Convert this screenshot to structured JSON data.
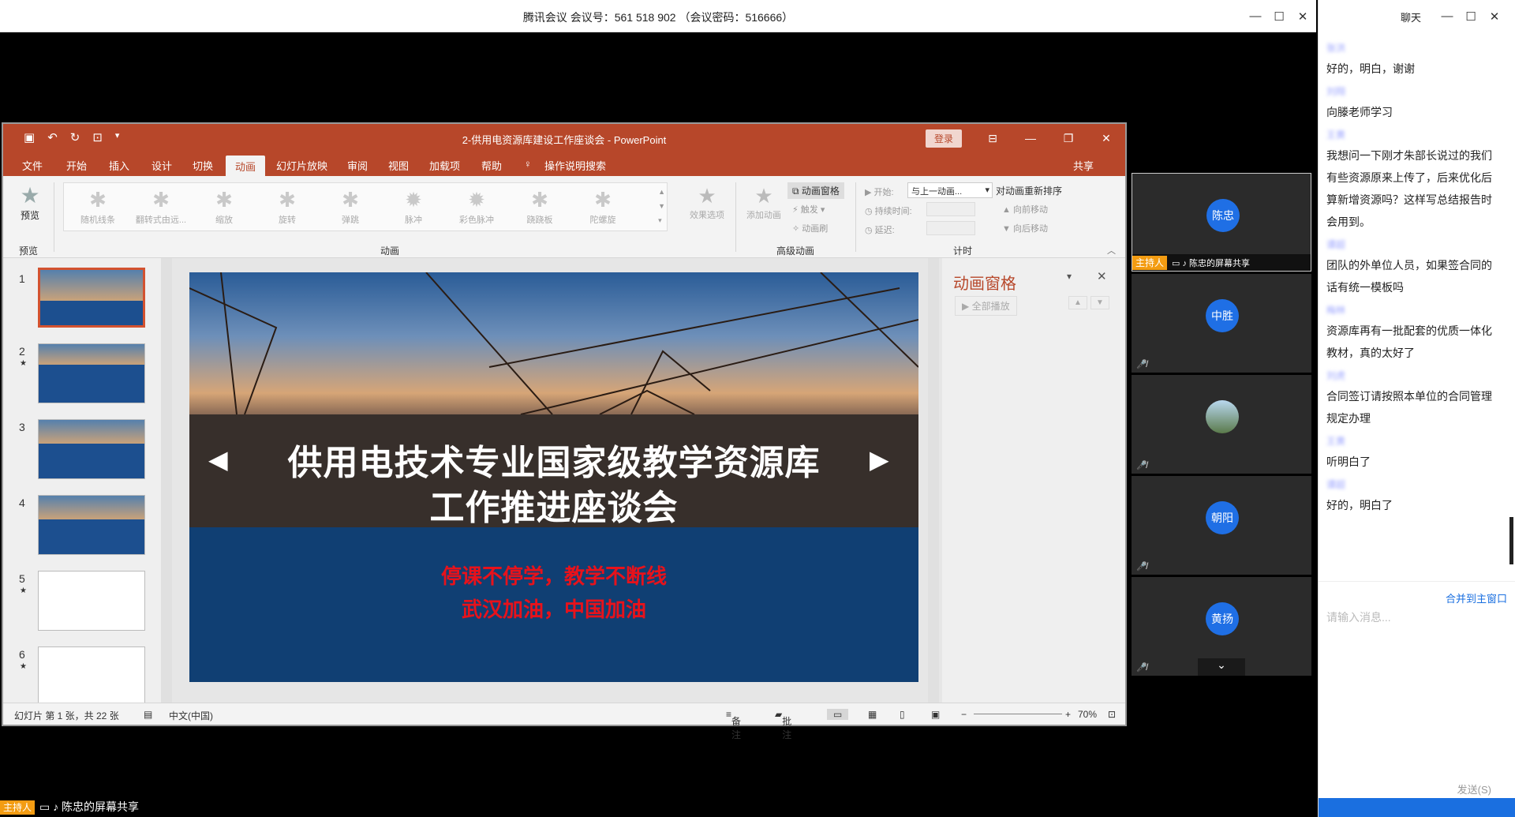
{
  "meeting": {
    "title": "腾讯会议 会议号：561 518 902 （会议密码：516666）",
    "win_min": "—",
    "win_max": "☐",
    "win_close": "✕"
  },
  "ppt": {
    "title": "2-供用电资源库建设工作座谈会  -  PowerPoint",
    "login": "登录",
    "tabs": [
      "文件",
      "开始",
      "插入",
      "设计",
      "切换",
      "动画",
      "幻灯片放映",
      "审阅",
      "视图",
      "加载项",
      "帮助",
      "操作说明搜索",
      "共享"
    ],
    "preview_label": "预览",
    "preview_group": "预览",
    "animations": [
      "随机线条",
      "翻转式由远...",
      "缩放",
      "旋转",
      "弹跳",
      "脉冲",
      "彩色脉冲",
      "跷跷板",
      "陀螺旋"
    ],
    "effect_options": "效果选项",
    "anim_group": "动画",
    "add_anim": "添加动画",
    "anim_pane_btn": "动画窗格",
    "trigger": "触发",
    "anim_brush": "动画刷",
    "adv_group": "高级动画",
    "start_label": "开始:",
    "start_value": "与上一动画...",
    "duration_label": "持续时间:",
    "delay_label": "延迟:",
    "timing_group": "计时",
    "reorder": "对动画重新排序",
    "move_earlier": "向前移动",
    "move_later": "向后移动",
    "slide_nums": [
      "1",
      "2",
      "3",
      "4",
      "5",
      "6"
    ],
    "slide_title_1": "供用电技术专业国家级教学资源库",
    "slide_title_2": "工作推进座谈会",
    "slide_red_1": "停课不停学，教学不断线",
    "slide_red_2": "武汉加油，中国加油",
    "anim_pane_title": "动画窗格",
    "play_all": "全部播放",
    "status_slide": "幻灯片 第 1 张，共 22 张",
    "status_lang": "中文(中国)",
    "status_notes": "备注",
    "status_comments": "批注",
    "zoom": "70%"
  },
  "video": {
    "tiles": [
      {
        "avatar": "陈忠",
        "label": "陈忠的屏幕共享",
        "host": "主持人"
      },
      {
        "avatar": "中胜",
        "label": ""
      },
      {
        "avatar": "",
        "label": ""
      },
      {
        "avatar": "朝阳",
        "label": ""
      },
      {
        "avatar": "黄扬",
        "label": ""
      }
    ]
  },
  "chat": {
    "title": "聊天",
    "messages": [
      {
        "sender": "张洪",
        "text": "好的，明白，谢谢"
      },
      {
        "sender": "刘翔",
        "text": "向滕老师学习"
      },
      {
        "sender": "王黄",
        "text": "我想问一下刚才朱部长说过的我们有些资源原来上传了，后来优化后算新增资源吗？这样写总结报告时会用到。"
      },
      {
        "sender": "谭超",
        "text": "团队的外单位人员，如果签合同的话有统一模板吗"
      },
      {
        "sender": "梅林",
        "text": "资源库再有一批配套的优质一体化教材，真的太好了"
      },
      {
        "sender": "刘虎",
        "text": "合同签订请按照本单位的合同管理规定办理"
      },
      {
        "sender": "王黄",
        "text": "听明白了"
      },
      {
        "sender": "谭超",
        "text": "好的，明白了"
      }
    ],
    "merge": "合并到主窗口",
    "placeholder": "请输入消息...",
    "send": "发送(S)"
  },
  "sharebar": {
    "host": "主持人",
    "label": "陈忠的屏幕共享"
  }
}
